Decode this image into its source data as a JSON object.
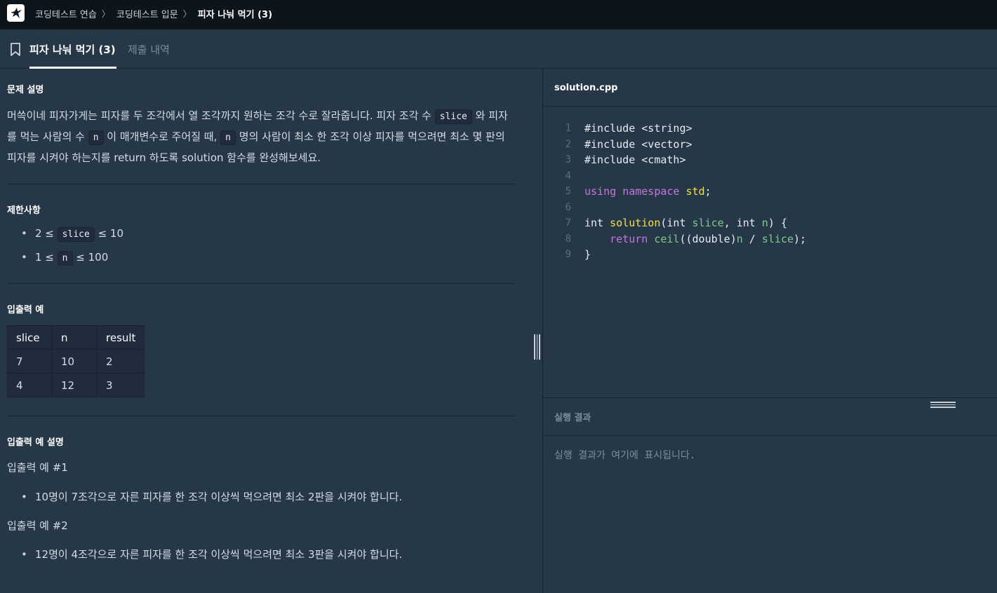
{
  "topbar": {
    "logo_icon": "programmers-logo-icon",
    "breadcrumbs": [
      {
        "label": "코딩테스트 연습"
      },
      {
        "label": "코딩테스트 입문"
      },
      {
        "label": "피자 나눠 먹기 (3)"
      }
    ]
  },
  "tabs": {
    "active": "피자 나눠 먹기 (3)",
    "inactive": "제출 내역"
  },
  "problem": {
    "description_heading": "문제 설명",
    "desc_part1": "머쓱이네 피자가게는 피자를 두 조각에서 열 조각까지 원하는 조각 수로 잘라줍니다. 피자 조각 수",
    "desc_code1": "slice",
    "desc_part2": "와 피자를 먹는 사람의 수",
    "desc_code2": "n",
    "desc_part3": "이 매개변수로 주어질 때,",
    "desc_code3": "n",
    "desc_part4": "명의 사람이 최소 한 조각 이상 피자를 먹으려면 최소 몇 판의 피자를 시켜야 하는지를 return 하도록 solution 함수를 완성해보세요.",
    "constraints_heading": "제한사항",
    "constraints": [
      {
        "pre": "2 ≤",
        "code": "slice",
        "post": "≤ 10"
      },
      {
        "pre": "1 ≤",
        "code": "n",
        "post": "≤ 100"
      }
    ],
    "examples_heading": "입출력 예",
    "table_headers": [
      "slice",
      "n",
      "result"
    ],
    "table_rows": [
      [
        "7",
        "10",
        "2"
      ],
      [
        "4",
        "12",
        "3"
      ]
    ],
    "explanation_heading": "입출력 예 설명",
    "example1_title": "입출력 예 #1",
    "example1_item": "10명이 7조각으로 자른 피자를 한 조각 이상씩 먹으려면 최소 2판을 시켜야 합니다.",
    "example2_title": "입출력 예 #2",
    "example2_item": "12명이 4조각으로 자른 피자를 한 조각 이상씩 먹으려면 최소 3판을 시켜야 합니다."
  },
  "editor": {
    "file_name": "solution.cpp",
    "line_numbers": [
      "1",
      "2",
      "3",
      "4",
      "5",
      "6",
      "7",
      "8",
      "9"
    ],
    "lines": [
      "#include <string>",
      "#include <vector>",
      "#include <cmath>",
      "",
      "using namespace std;",
      "",
      "int solution(int slice, int n) {",
      "    return ceil((double)n / slice);",
      "}"
    ]
  },
  "result": {
    "label": "실행 결과",
    "placeholder": "실행 결과가 여기에 표시됩니다."
  }
}
